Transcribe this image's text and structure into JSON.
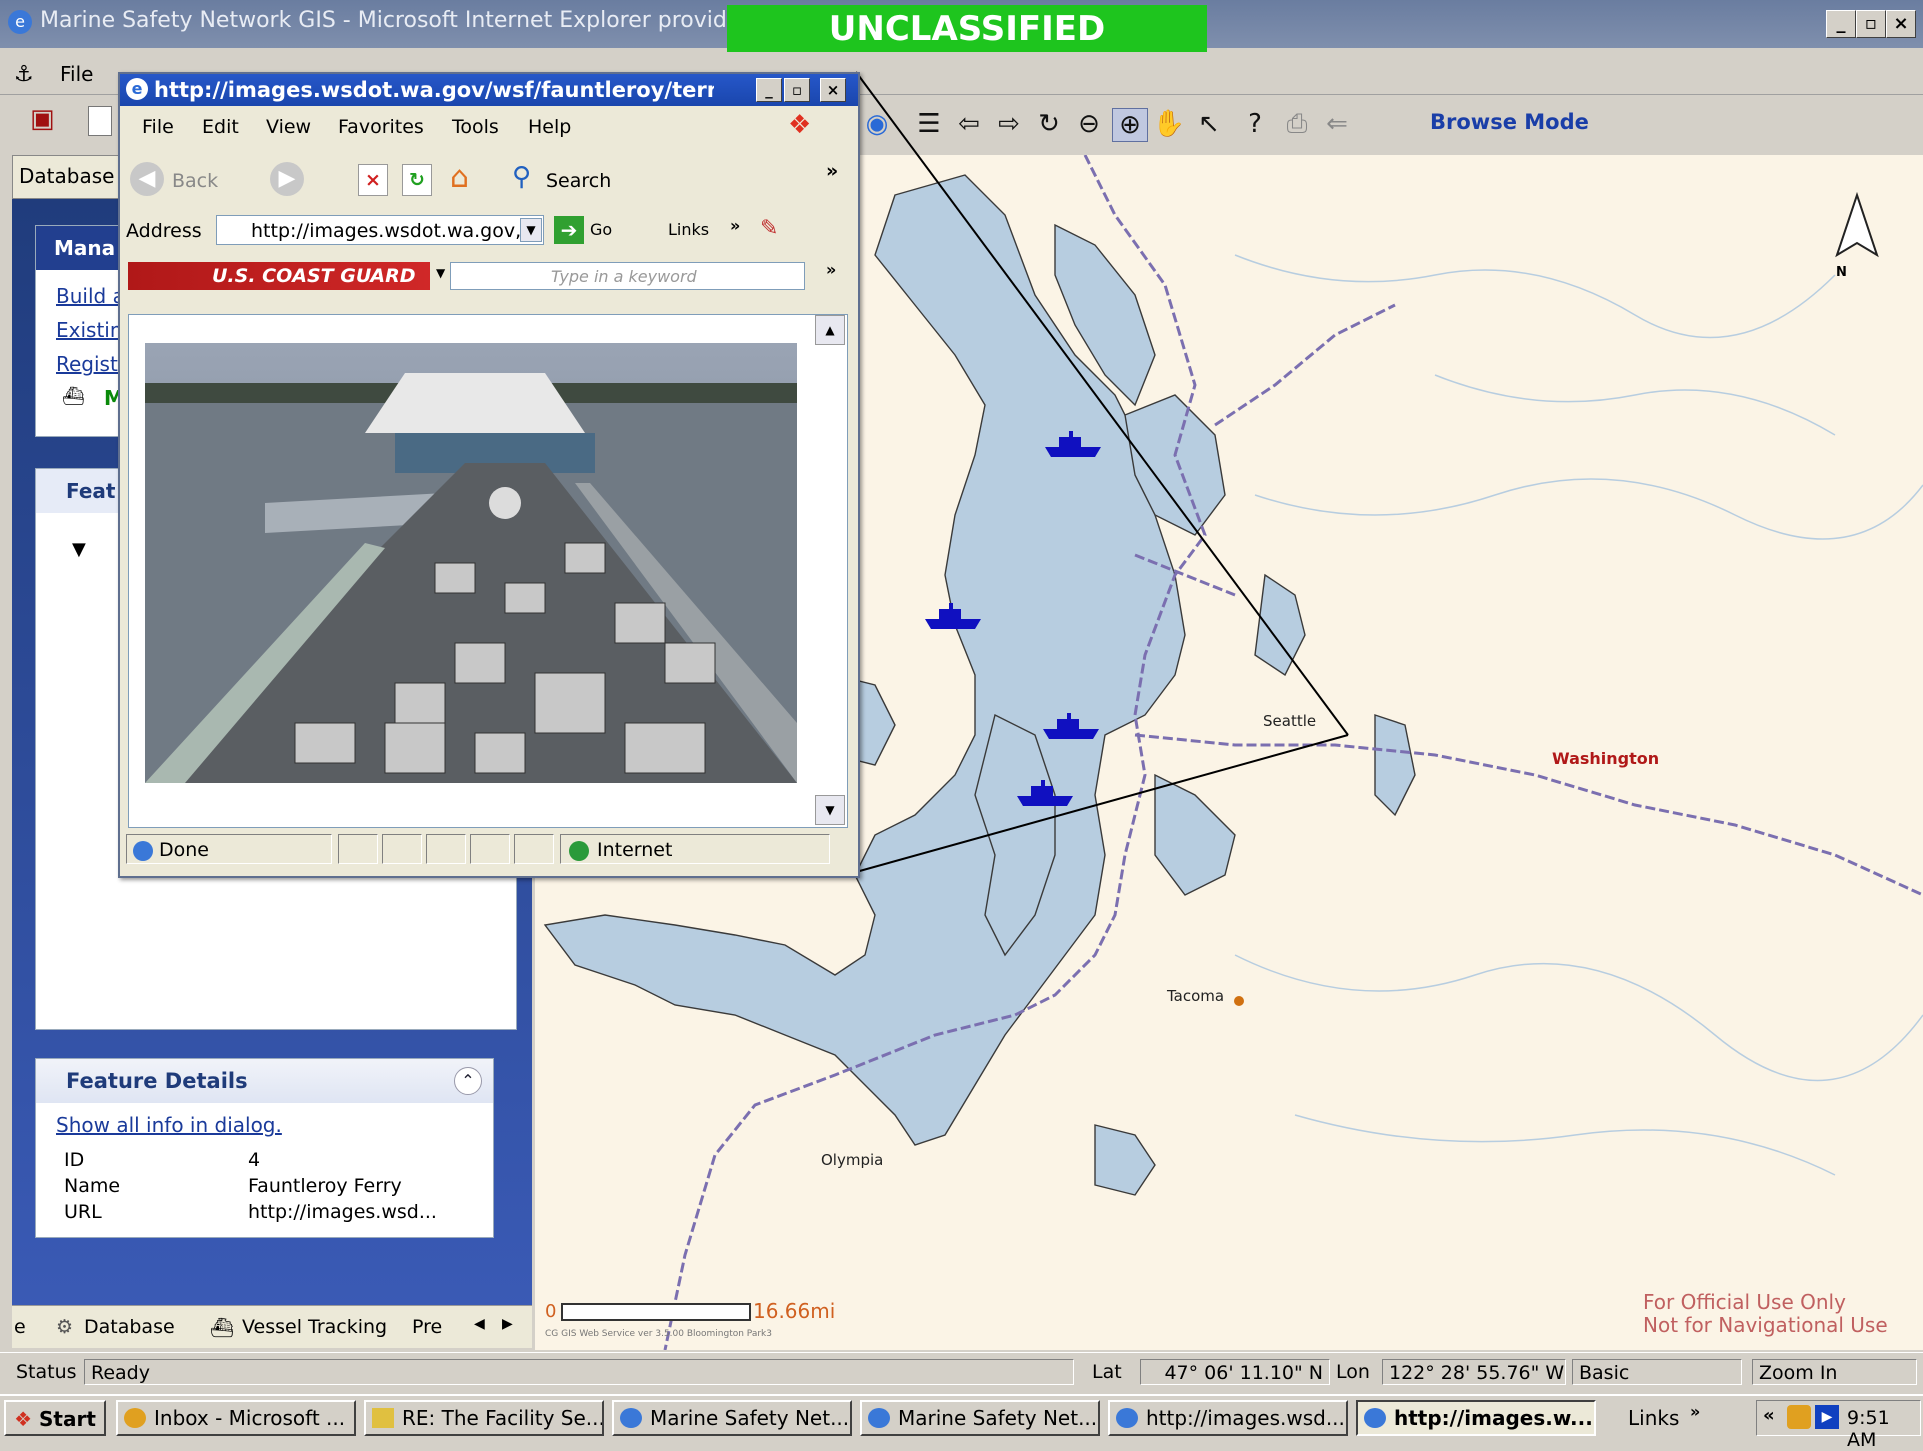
{
  "main_window": {
    "title": "Marine Safety Network GIS - Microsoft Internet Explorer provided",
    "classification": "UNCLASSIFIED",
    "menu": {
      "file": "File"
    }
  },
  "map_toolbar": {
    "browse_mode": "Browse Mode"
  },
  "left_panel": {
    "database_tab": "Database",
    "manage": {
      "header": "Mana",
      "links": [
        "Build a",
        "Existin",
        "Registe"
      ],
      "vessel_item": "M"
    },
    "features": {
      "header": "Feat"
    },
    "feature_details": {
      "title": "Feature Details",
      "show_all": "Show all info in dialog.",
      "rows": [
        {
          "label": "ID",
          "value": "4"
        },
        {
          "label": "Name",
          "value": "Fauntleroy Ferry"
        },
        {
          "label": "URL",
          "value": "http://images.wsd..."
        }
      ]
    },
    "bottom_tabs": [
      "e",
      "Database",
      "Vessel Tracking",
      "Pre"
    ]
  },
  "map": {
    "labels": {
      "seattle": "Seattle",
      "tacoma": "Tacoma",
      "olympia": "Olympia",
      "washington": "Washington"
    },
    "scale": {
      "min": "0",
      "max": "16.66mi"
    },
    "credit": "CG GIS Web Service ver 3.5.00 Bloomington Park3",
    "disclaimer_line1": "For Official Use Only",
    "disclaimer_line2": "Not for Navigational Use",
    "north_label": "N",
    "colors": {
      "water": "#b7cde0",
      "land": "#fbf4e6",
      "road": "#7b6fb0",
      "vessel": "#1010c0"
    }
  },
  "status_bar": {
    "status_label": "Status",
    "status_value": "Ready",
    "lat_label": "Lat",
    "lat_value": "47° 06' 11.10\" N",
    "lon_label": "Lon",
    "lon_value": "122° 28' 55.76\" W",
    "mode": "Basic",
    "tool": "Zoom In"
  },
  "taskbar": {
    "start": "Start",
    "buttons": [
      "Inbox - Microsoft ...",
      "RE: The Facility Se...",
      "Marine Safety Net...",
      "Marine Safety Net...",
      "http://images.wsd...",
      "http://images.w..."
    ],
    "links": "Links",
    "clock": "9:51 AM"
  },
  "popup": {
    "title": "http://images.wsdot.wa.gov/wsf/fauntleroy/terminal...",
    "menu": [
      "File",
      "Edit",
      "View",
      "Favorites",
      "Tools",
      "Help"
    ],
    "back": "Back",
    "search": "Search",
    "address_label": "Address",
    "address_value": "http://images.wsdot.wa.gov,",
    "go": "Go",
    "links": "Links",
    "uscg": "U.S. COAST GUARD",
    "keyword_placeholder": "Type in a keyword",
    "status_done": "Done",
    "status_zone": "Internet"
  }
}
